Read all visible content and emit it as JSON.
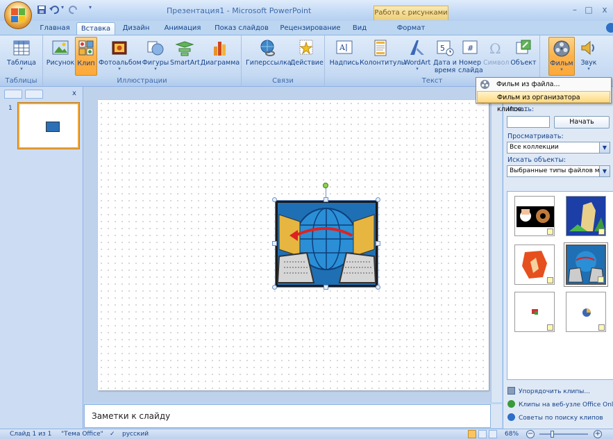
{
  "window": {
    "title": "Презентация1 - Microsoft PowerPoint",
    "contextual_tab": "Работа с рисунками",
    "minimize": "–",
    "restore": "□",
    "close": "x"
  },
  "tabs": [
    {
      "label": "Главная"
    },
    {
      "label": "Вставка",
      "active": true
    },
    {
      "label": "Дизайн"
    },
    {
      "label": "Анимация"
    },
    {
      "label": "Показ слайдов"
    },
    {
      "label": "Рецензирование"
    },
    {
      "label": "Вид"
    },
    {
      "label": "Формат"
    }
  ],
  "ribbon": {
    "groups": {
      "tables": "Таблицы",
      "illustrations": "Иллюстрации",
      "links": "Связи",
      "text": "Текст"
    },
    "buttons": {
      "table": "Таблица",
      "picture": "Рисунок",
      "clip": "Клип",
      "photoalbum": "Фотоальбом",
      "shapes": "Фигуры",
      "smartart": "SmartArt",
      "chart": "Диаграмма",
      "hyperlink": "Гиперссылка",
      "action": "Действие",
      "textbox": "Надпись",
      "header_footer": "Колонтитулы",
      "wordart": "WordArt",
      "datetime_1": "Дата и",
      "datetime_2": "время",
      "slidenum_1": "Номер",
      "slidenum_2": "слайда",
      "symbol": "Символ",
      "object": "Объект",
      "movie": "Фильм",
      "sound": "Звук"
    }
  },
  "film_menu": {
    "items": [
      {
        "label": "Фильм из файла...",
        "highlighted": false
      },
      {
        "label": "Фильм из организатора клипов...",
        "highlighted": true
      }
    ]
  },
  "slides_pane": {
    "close": "x",
    "thumb_number": "1"
  },
  "notes": {
    "placeholder": "Заметки к слайду"
  },
  "task_pane": {
    "search_label": "Искать:",
    "search_value": "",
    "search_button": "Начать",
    "browse_label": "Просматривать:",
    "browse_value": "Все коллекции",
    "types_label": "Искать объекты:",
    "types_value": "Выбранные типы файлов мул",
    "links": [
      {
        "label": "Упорядочить клипы..."
      },
      {
        "label": "Клипы на веб-узле Office Online"
      },
      {
        "label": "Советы по поиску клипов"
      }
    ]
  },
  "status": {
    "slide_info": "Слайд 1 из 1",
    "theme": "\"Тема Office\"",
    "language": "русский",
    "zoom": "68%",
    "zoom_minus": "−",
    "zoom_plus": "+"
  },
  "colors": {
    "accent": "#15428b",
    "pressed": "#fbb24b",
    "contextual": "#eccf79"
  }
}
